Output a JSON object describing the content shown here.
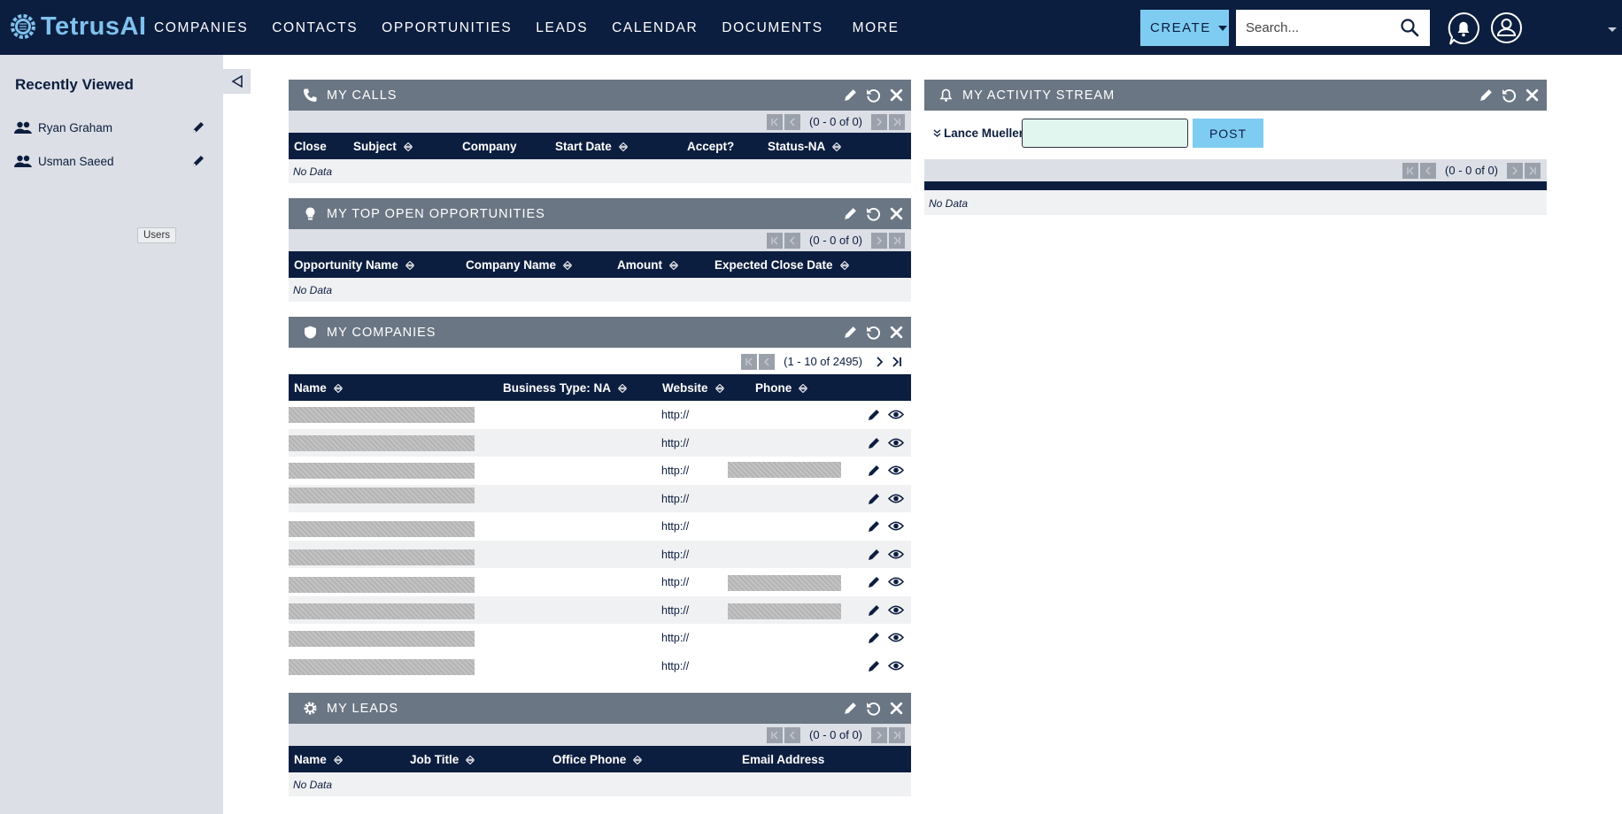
{
  "app": {
    "logo_text": "TetrusAI"
  },
  "nav": {
    "items": [
      "COMPANIES",
      "CONTACTS",
      "OPPORTUNITIES",
      "LEADS",
      "CALENDAR",
      "DOCUMENTS"
    ],
    "more": "MORE",
    "create_label": "CREATE",
    "search_placeholder": "Search..."
  },
  "sidebar": {
    "title": "Recently Viewed",
    "items": [
      {
        "label": "Ryan Graham"
      },
      {
        "label": "Usman Saeed"
      }
    ],
    "tooltip": "Users"
  },
  "dashlets": {
    "calls": {
      "title": "MY CALLS",
      "pagination": "(0 - 0 of 0)",
      "columns": [
        "Close",
        "Subject",
        "Company",
        "Start Date",
        "Accept?",
        "Status-NA"
      ],
      "empty": "No Data"
    },
    "opps": {
      "title": "MY TOP OPEN OPPORTUNITIES",
      "pagination": "(0 - 0 of 0)",
      "columns": [
        "Opportunity Name",
        "Company Name",
        "Amount",
        "Expected Close Date"
      ],
      "empty": "No Data"
    },
    "companies": {
      "title": "MY COMPANIES",
      "pagination": "(1 - 10 of 2495)",
      "columns": [
        "Name",
        "Business Type: NA",
        "Website",
        "Phone"
      ],
      "rows": [
        {
          "website": "http://"
        },
        {
          "website": "http://"
        },
        {
          "website": "http://"
        },
        {
          "website": "http://"
        },
        {
          "website": "http://"
        },
        {
          "website": "http://"
        },
        {
          "website": "http://"
        },
        {
          "website": "http://"
        },
        {
          "website": "http://"
        },
        {
          "website": "http://"
        }
      ]
    },
    "leads": {
      "title": "MY LEADS",
      "pagination": "(0 - 0 of 0)",
      "columns": [
        "Name",
        "Job Title",
        "Office Phone",
        "Email Address"
      ],
      "empty": "No Data"
    },
    "activity": {
      "title": "MY ACTIVITY STREAM",
      "user": "Lance Mueller",
      "post_label": "POST",
      "pagination": "(0 - 0 of 0)",
      "empty": "No Data"
    }
  },
  "colors": {
    "navy": "#0c1e3f",
    "header_gray": "#6b7684",
    "accent": "#7fccf3",
    "logo": "#7fc1ec"
  }
}
